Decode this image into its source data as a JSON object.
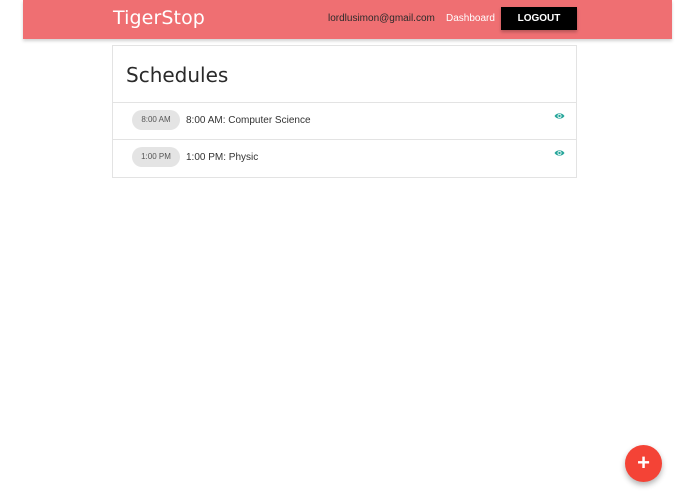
{
  "navbar": {
    "brand": "TigerStop",
    "email": "lordlusimon@gmail.com",
    "dashboard_link": "Dashboard",
    "logout_label": "LOGOUT",
    "background_color": "#ef6f72"
  },
  "schedules": {
    "title": "Schedules",
    "items": [
      {
        "time_chip": "8:00 AM",
        "text": "8:00 AM: Computer Science",
        "icon": "eye-icon"
      },
      {
        "time_chip": "1:00 PM",
        "text": "1:00 PM: Physic",
        "icon": "eye-icon"
      }
    ]
  },
  "fab": {
    "icon": "plus-icon",
    "symbol": "+",
    "color": "#f44336"
  }
}
